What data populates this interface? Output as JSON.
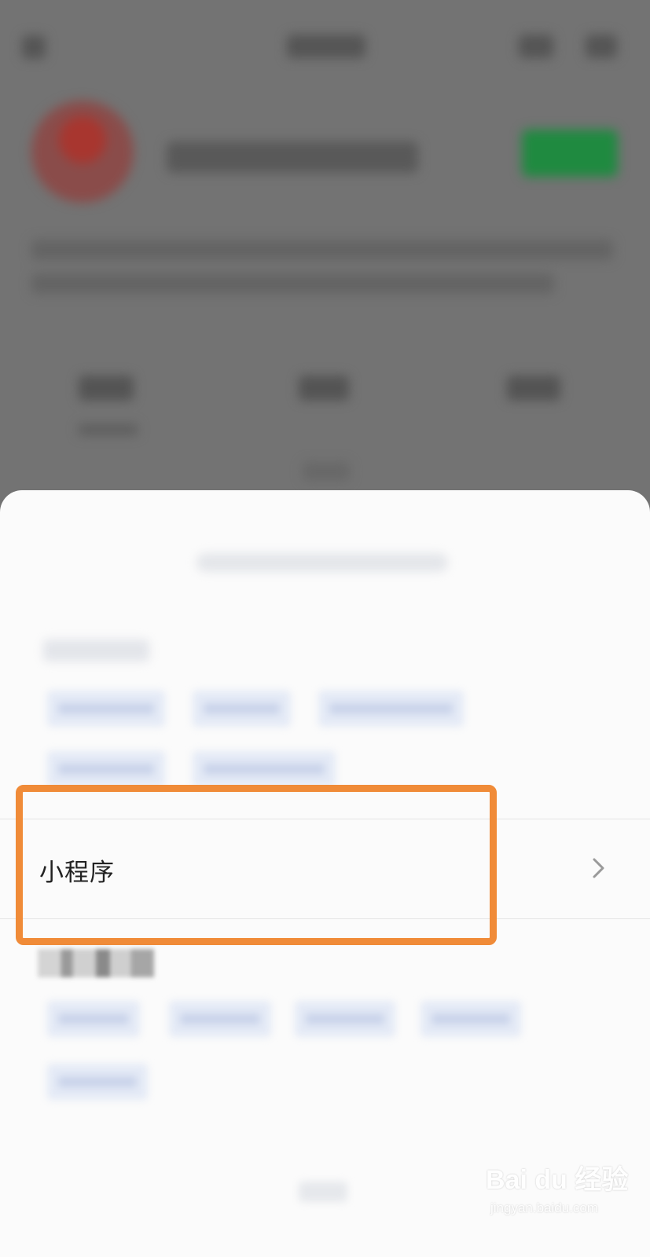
{
  "mini_program_row": {
    "label": "小程序",
    "chevron_icon": "chevron-right-icon"
  },
  "highlight": {
    "color": "#f08b38"
  },
  "watermark": {
    "main": "Bai du 经验",
    "sub": "jingyan.baidu.com"
  },
  "colors": {
    "overlay": "#737373",
    "follow_button": "#1f8a40",
    "sheet": "#fbfbfb",
    "chip": "#e4eaf6"
  }
}
